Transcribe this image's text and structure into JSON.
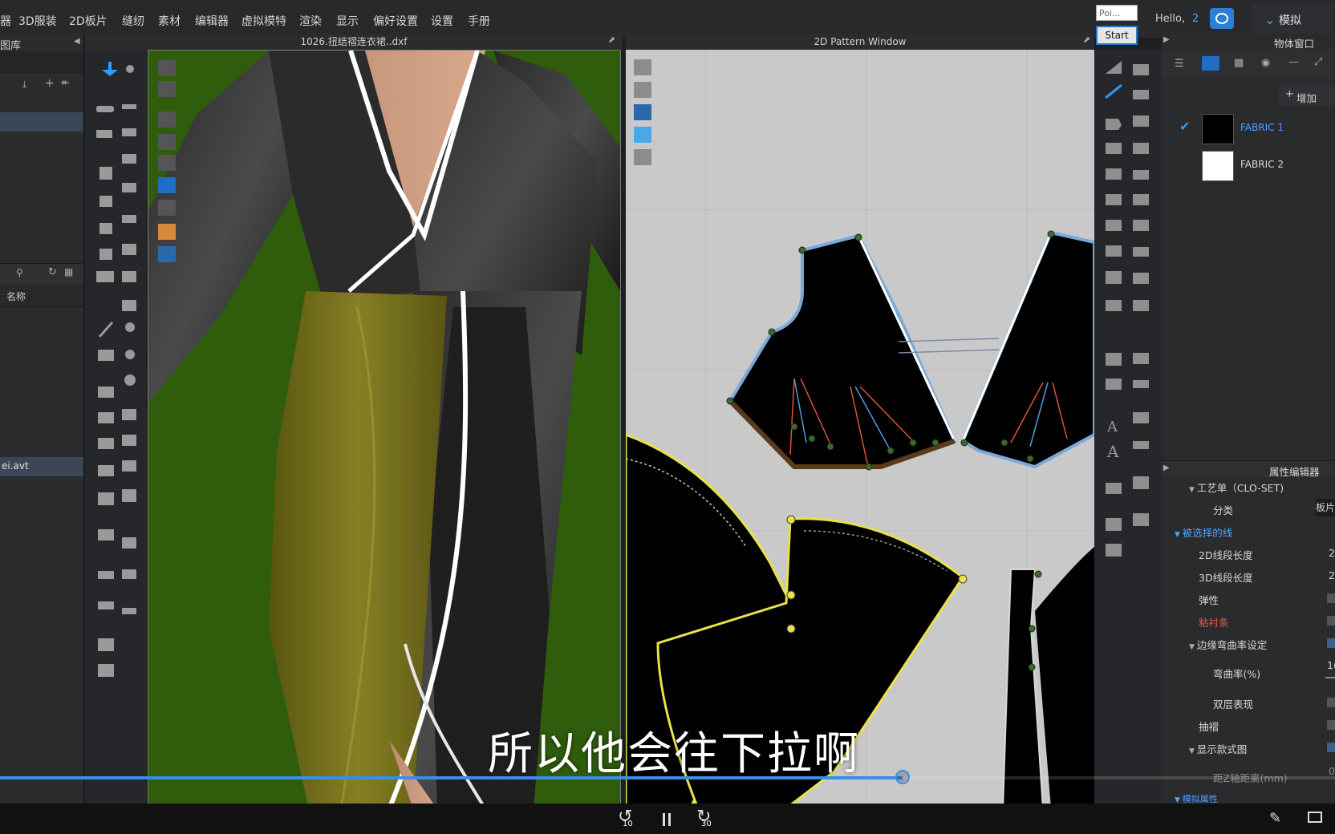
{
  "menu": {
    "items": [
      "3D服装",
      "2D板片",
      "缝纫",
      "素材",
      "编辑器",
      "虚拟模特",
      "渲染",
      "显示",
      "偏好设置",
      "设置",
      "手册"
    ],
    "first_partial": "器"
  },
  "popup": {
    "label": "Poi...",
    "start": "Start"
  },
  "user": {
    "hello": "Hello,",
    "count": "2"
  },
  "sim_button": "模拟",
  "library": {
    "title": "图库",
    "name_col": "名称",
    "file": "ei.avt"
  },
  "window3d": {
    "title": "1026.扭结褶连衣裙..dxf"
  },
  "window2d": {
    "title": "2D Pattern Window"
  },
  "object_window": {
    "title": "物体窗口",
    "add_label": "增加",
    "fabrics": [
      {
        "name": "FABRIC 1",
        "color": "#000000",
        "selected": true
      },
      {
        "name": "FABRIC 2",
        "color": "#ffffff",
        "selected": false
      }
    ]
  },
  "property_editor": {
    "title": "属性编辑器",
    "rows": [
      {
        "label": "工艺单（CLO-SET)",
        "value": ""
      },
      {
        "label": "分类",
        "value": "板片"
      },
      {
        "label": "被选择的线",
        "value": ""
      },
      {
        "label": "2D线段长度",
        "value": "2"
      },
      {
        "label": "3D线段长度",
        "value": "2"
      },
      {
        "label": "弹性",
        "value": ""
      },
      {
        "label": "粘衬条",
        "value": ""
      },
      {
        "label": "边缘弯曲率设定",
        "value": ""
      },
      {
        "label": "弯曲率(%)",
        "value": "1("
      },
      {
        "label": "双层表现",
        "value": ""
      },
      {
        "label": "抽褶",
        "value": ""
      },
      {
        "label": "显示款式图",
        "value": ""
      },
      {
        "label": "距Z轴距离(mm)",
        "value": "0"
      },
      {
        "label": "模拟属性",
        "value": ""
      }
    ]
  },
  "subtitle": "所以他会往下拉啊",
  "player": {
    "rewind": "10",
    "forward": "30",
    "progress": 0.676
  }
}
